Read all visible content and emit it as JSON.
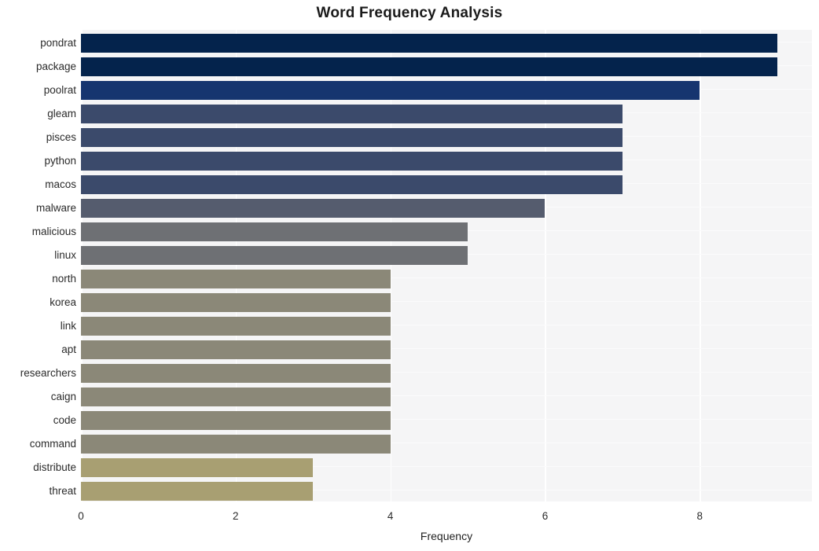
{
  "chart_data": {
    "type": "bar",
    "orientation": "horizontal",
    "title": "Word Frequency Analysis",
    "xlabel": "Frequency",
    "ylabel": "",
    "categories": [
      "pondrat",
      "package",
      "poolrat",
      "gleam",
      "pisces",
      "python",
      "macos",
      "malware",
      "malicious",
      "linux",
      "north",
      "korea",
      "link",
      "apt",
      "researchers",
      "caign",
      "code",
      "command",
      "distribute",
      "threat"
    ],
    "values": [
      9,
      9,
      8,
      7,
      7,
      7,
      7,
      6,
      5,
      5,
      4,
      4,
      4,
      4,
      4,
      4,
      4,
      4,
      3,
      3
    ],
    "bar_colors": [
      "#04234c",
      "#04234c",
      "#16356f",
      "#3b4a6b",
      "#3b4a6b",
      "#3b4a6b",
      "#3b4a6b",
      "#555c6e",
      "#6e7074",
      "#6e7074",
      "#8b8878",
      "#8b8878",
      "#8b8878",
      "#8b8878",
      "#8b8878",
      "#8b8878",
      "#8b8878",
      "#8b8878",
      "#a89f72",
      "#a89f72"
    ],
    "xlim": [
      0,
      9.45
    ],
    "ylim_categories": 20,
    "xticks": [
      0,
      2,
      4,
      6,
      8
    ],
    "xticklabels": [
      "0",
      "2",
      "4",
      "6",
      "8"
    ],
    "grid": "both",
    "grid_color": "#ffffff",
    "plot_background": "#f5f5f6",
    "figure_background": "#ffffff",
    "legend": "none",
    "title_color": "#1a1a1a",
    "tick_color": "#2b2b2b"
  }
}
